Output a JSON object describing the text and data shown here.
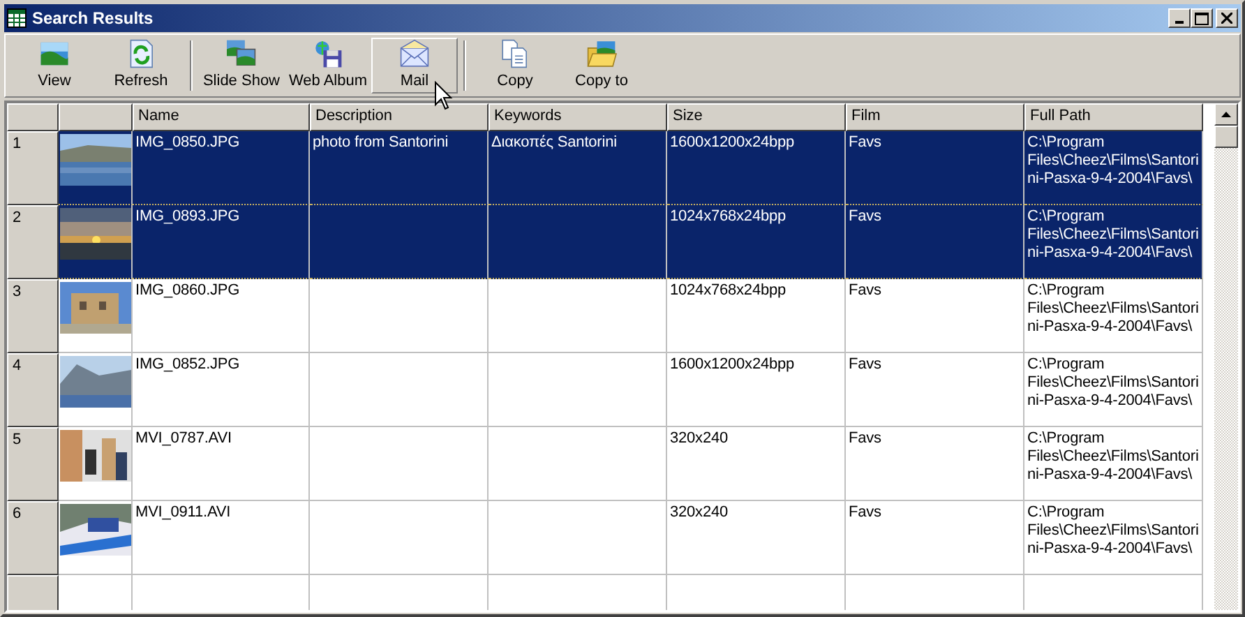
{
  "window": {
    "title": "Search Results"
  },
  "toolbar": [
    {
      "kind": "button",
      "label": "View",
      "hot": false
    },
    {
      "kind": "button",
      "label": "Refresh",
      "hot": false
    },
    {
      "kind": "separator"
    },
    {
      "kind": "button",
      "label": "Slide Show",
      "hot": false
    },
    {
      "kind": "button",
      "label": "Web Album",
      "hot": false
    },
    {
      "kind": "button",
      "label": "Mail",
      "hot": true
    },
    {
      "kind": "separator"
    },
    {
      "kind": "button",
      "label": "Copy",
      "hot": false
    },
    {
      "kind": "button",
      "label": "Copy to",
      "hot": false
    }
  ],
  "table": {
    "columns": [
      "Name",
      "Description",
      "Keywords",
      "Size",
      "Film",
      "Full Path"
    ],
    "rows": [
      {
        "number": "1",
        "selected": true,
        "cells": [
          "IMG_0850.JPG",
          "photo from Santorini",
          "Διακοπές Santorini",
          "1600x1200x24bpp",
          "Favs",
          "C:\\Program Files\\Cheez\\Films\\Santorini-Pasxa-9-4-2004\\Favs\\"
        ]
      },
      {
        "number": "2",
        "selected": true,
        "cells": [
          "IMG_0893.JPG",
          "",
          "",
          "1024x768x24bpp",
          "Favs",
          "C:\\Program Files\\Cheez\\Films\\Santorini-Pasxa-9-4-2004\\Favs\\"
        ]
      },
      {
        "number": "3",
        "selected": false,
        "cells": [
          "IMG_0860.JPG",
          "",
          "",
          "1024x768x24bpp",
          "Favs",
          "C:\\Program Files\\Cheez\\Films\\Santorini-Pasxa-9-4-2004\\Favs\\"
        ]
      },
      {
        "number": "4",
        "selected": false,
        "cells": [
          "IMG_0852.JPG",
          "",
          "",
          "1600x1200x24bpp",
          "Favs",
          "C:\\Program Files\\Cheez\\Films\\Santorini-Pasxa-9-4-2004\\Favs\\"
        ]
      },
      {
        "number": "5",
        "selected": false,
        "cells": [
          "MVI_0787.AVI",
          "",
          "",
          "320x240",
          "Favs",
          "C:\\Program Files\\Cheez\\Films\\Santorini-Pasxa-9-4-2004\\Favs\\"
        ]
      },
      {
        "number": "6",
        "selected": false,
        "cells": [
          "MVI_0911.AVI",
          "",
          "",
          "320x240",
          "Favs",
          "C:\\Program Files\\Cheez\\Films\\Santorini-Pasxa-9-4-2004\\Favs\\"
        ]
      }
    ]
  }
}
